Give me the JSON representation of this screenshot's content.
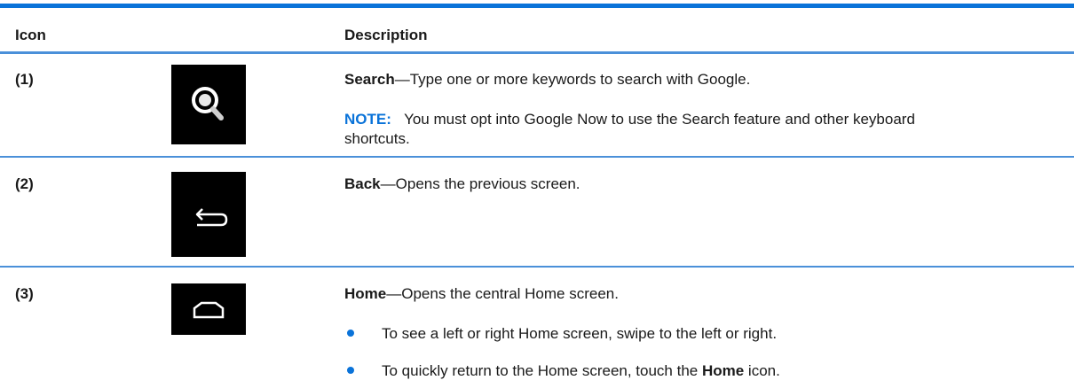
{
  "table": {
    "headers": {
      "icon": "Icon",
      "description": "Description"
    },
    "rows": [
      {
        "number": "(1)",
        "icon": "search-magnifier-icon",
        "title": "Search",
        "dash": "—",
        "text": "Type one or more keywords to search with Google.",
        "note_label": "NOTE:",
        "note_text": "You must opt into Google Now to use the Search feature and other keyboard",
        "note_text_2": "shortcuts."
      },
      {
        "number": "(2)",
        "icon": "back-arrow-icon",
        "title": "Back",
        "dash": "—",
        "text": "Opens the previous screen."
      },
      {
        "number": "(3)",
        "icon": "home-icon",
        "title": "Home",
        "dash": "—",
        "text": "Opens the central Home screen.",
        "bullets": [
          {
            "text": "To see a left or right Home screen, swipe to the left or right."
          },
          {
            "text_before": "To quickly return to the Home screen, touch the ",
            "bold": "Home",
            "text_after": " icon."
          }
        ]
      }
    ]
  },
  "colors": {
    "accent": "#0a73d9",
    "rule": "#4a90d9",
    "icon_bg": "#000000"
  }
}
